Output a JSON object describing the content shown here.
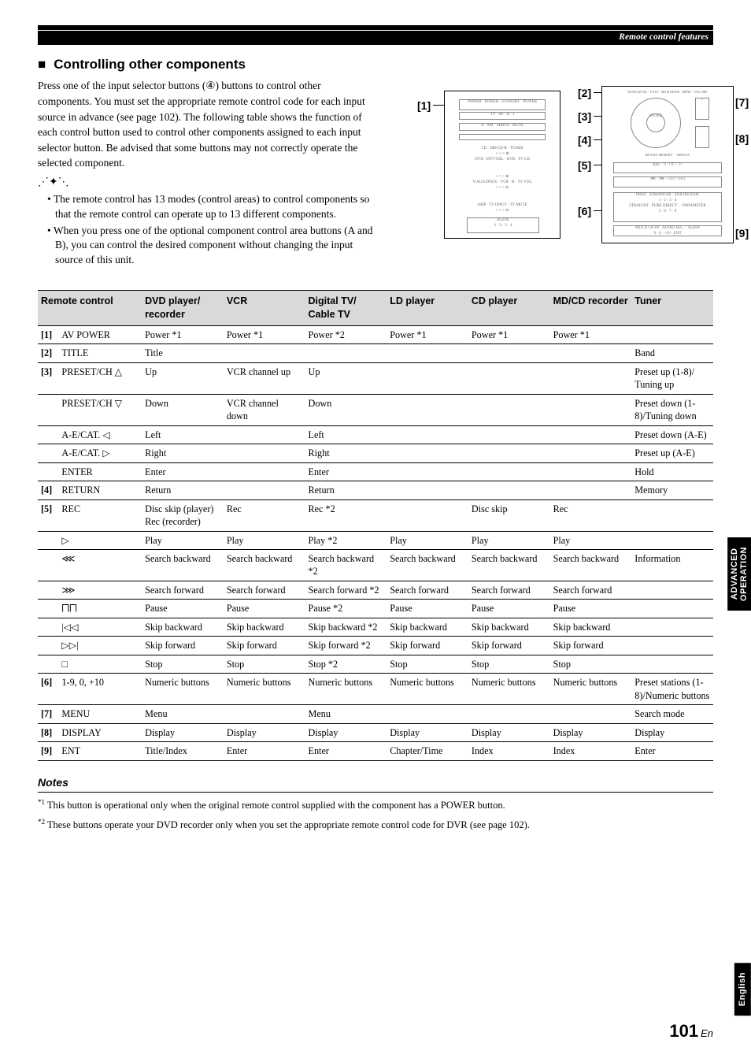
{
  "breadcrumb": "Remote control features",
  "section_heading": "Controlling other components",
  "intro": "Press one of the input selector buttons (④) buttons to control other components.  You must set the appropriate remote control code for each input source in advance (see page 102). The following table shows the function of each control button used to control other components assigned to each input selector button. Be advised that some buttons may not correctly operate the selected component.",
  "bullets": [
    "The remote control has 13 modes (control areas) to control components so that the remote control can operate up to 13 different components.",
    "When you press one of the optional component control area buttons (A and B), you can control the desired component without changing the input source of this unit."
  ],
  "callouts": {
    "c1": "[1]",
    "c2": "[2]",
    "c3": "[3]",
    "c4": "[4]",
    "c5": "[5]",
    "c6": "[6]",
    "c7": "[7]",
    "c8": "[8]",
    "c9": "[9]"
  },
  "table": {
    "headers": [
      "Remote control",
      "DVD player/ recorder",
      "VCR",
      "Digital TV/ Cable TV",
      "LD player",
      "CD player",
      "MD/CD recorder",
      "Tuner"
    ],
    "rows": [
      {
        "idx": "[1]",
        "rc": "AV POWER",
        "cells": [
          "Power *1",
          "Power *1",
          "Power *2",
          "Power *1",
          "Power *1",
          "Power *1",
          ""
        ]
      },
      {
        "idx": "[2]",
        "rc": "TITLE",
        "cells": [
          "Title",
          "",
          "",
          "",
          "",
          "",
          "Band"
        ]
      },
      {
        "idx": "[3]",
        "rc": "PRESET/CH △",
        "cells": [
          "Up",
          "VCR channel up",
          "Up",
          "",
          "",
          "",
          "Preset up (1-8)/ Tuning up"
        ]
      },
      {
        "idx": "",
        "rc": "PRESET/CH ▽",
        "cells": [
          "Down",
          "VCR channel down",
          "Down",
          "",
          "",
          "",
          "Preset down (1-8)/Tuning down"
        ]
      },
      {
        "idx": "",
        "rc": "A-E/CAT. ◁",
        "cells": [
          "Left",
          "",
          "Left",
          "",
          "",
          "",
          "Preset down (A-E)"
        ]
      },
      {
        "idx": "",
        "rc": "A-E/CAT. ▷",
        "cells": [
          "Right",
          "",
          "Right",
          "",
          "",
          "",
          "Preset up (A-E)"
        ]
      },
      {
        "idx": "",
        "rc": "ENTER",
        "cells": [
          "Enter",
          "",
          "Enter",
          "",
          "",
          "",
          "Hold"
        ]
      },
      {
        "idx": "[4]",
        "rc": "RETURN",
        "cells": [
          "Return",
          "",
          "Return",
          "",
          "",
          "",
          "Memory"
        ]
      },
      {
        "idx": "[5]",
        "rc": "REC",
        "cells": [
          "Disc skip (player) Rec (recorder)",
          "Rec",
          "Rec *2",
          "",
          "Disc skip",
          "Rec",
          ""
        ]
      },
      {
        "idx": "",
        "rc": "▷",
        "cells": [
          "Play",
          "Play",
          "Play *2",
          "Play",
          "Play",
          "Play",
          ""
        ]
      },
      {
        "idx": "",
        "rc": "⋘",
        "cells": [
          "Search backward",
          "Search backward",
          "Search backward *2",
          "Search backward",
          "Search backward",
          "Search backward",
          "Information"
        ]
      },
      {
        "idx": "",
        "rc": "⋙",
        "cells": [
          "Search forward",
          "Search forward",
          "Search forward *2",
          "Search forward",
          "Search forward",
          "Search forward",
          ""
        ]
      },
      {
        "idx": "",
        "rc": "⨅⨅",
        "cells": [
          "Pause",
          "Pause",
          "Pause *2",
          "Pause",
          "Pause",
          "Pause",
          ""
        ]
      },
      {
        "idx": "",
        "rc": "|◁◁",
        "cells": [
          "Skip backward",
          "Skip backward",
          "Skip backward *2",
          "Skip backward",
          "Skip backward",
          "Skip backward",
          ""
        ]
      },
      {
        "idx": "",
        "rc": "▷▷|",
        "cells": [
          "Skip forward",
          "Skip forward",
          "Skip forward *2",
          "Skip forward",
          "Skip forward",
          "Skip forward",
          ""
        ]
      },
      {
        "idx": "",
        "rc": "□",
        "cells": [
          "Stop",
          "Stop",
          "Stop *2",
          "Stop",
          "Stop",
          "Stop",
          ""
        ]
      },
      {
        "idx": "[6]",
        "rc": "1-9, 0, +10",
        "cells": [
          "Numeric buttons",
          "Numeric buttons",
          "Numeric buttons",
          "Numeric buttons",
          "Numeric buttons",
          "Numeric buttons",
          "Preset stations (1-8)/Numeric buttons"
        ]
      },
      {
        "idx": "[7]",
        "rc": "MENU",
        "cells": [
          "Menu",
          "",
          "Menu",
          "",
          "",
          "",
          "Search mode"
        ]
      },
      {
        "idx": "[8]",
        "rc": "DISPLAY",
        "cells": [
          "Display",
          "Display",
          "Display",
          "Display",
          "Display",
          "Display",
          "Display"
        ]
      },
      {
        "idx": "[9]",
        "rc": "ENT",
        "cells": [
          "Title/Index",
          "Enter",
          "Enter",
          "Chapter/Time",
          "Index",
          "Index",
          "Enter"
        ]
      }
    ]
  },
  "notes_heading": "Notes",
  "notes": [
    {
      "sup": "*1",
      "text": "This button is operational only when the original remote control supplied with the component has a POWER button."
    },
    {
      "sup": "*2",
      "text": "These buttons operate your DVD recorder only when you set the appropriate remote control code for DVR (see page 102)."
    }
  ],
  "side_tab_1a": "ADVANCED",
  "side_tab_1b": "OPERATION",
  "side_tab_2": "English",
  "page_number": "101",
  "page_suffix": "En"
}
